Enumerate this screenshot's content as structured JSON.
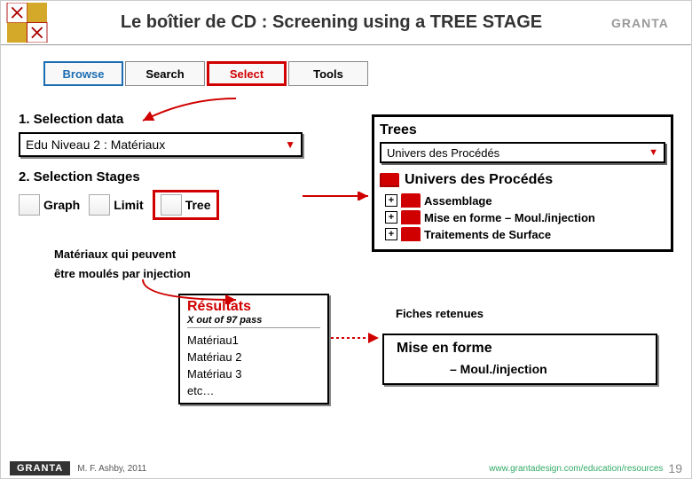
{
  "header": {
    "title": "Le boîtier de CD : Screening using a TREE STAGE",
    "logo_right": "GRANTA"
  },
  "tabs": {
    "browse": "Browse",
    "search": "Search",
    "select": "Select",
    "tools": "Tools"
  },
  "selection_data": {
    "label": "1. Selection data",
    "value": "Edu Niveau 2 : Matériaux"
  },
  "selection_stages": {
    "label": "2. Selection Stages",
    "graph": "Graph",
    "limit": "Limit",
    "tree": "Tree"
  },
  "mid_note": {
    "line1": "Matériaux qui peuvent",
    "line2": "être moulés par injection"
  },
  "results": {
    "title": "Résultats",
    "subtitle": "X out of 97 pass",
    "items": [
      "Matériau1",
      "Matériau 2",
      "Matériau 3",
      "etc…"
    ]
  },
  "right_panel": {
    "title": "Trees",
    "dropdown": "Univers des Procédés",
    "root": "Univers des Procédés",
    "children": [
      "Assemblage",
      "Mise en forme – Moul./injection",
      "Traitements de Surface"
    ]
  },
  "fiches": "Fiches retenues",
  "mise_box": {
    "title": "Mise en forme",
    "sub": "– Moul./injection"
  },
  "footer": {
    "logo": "GRANTA",
    "cite": "M. F. Ashby, 2011",
    "url": "www.grantadesign.com/education/resources",
    "page": "19"
  }
}
